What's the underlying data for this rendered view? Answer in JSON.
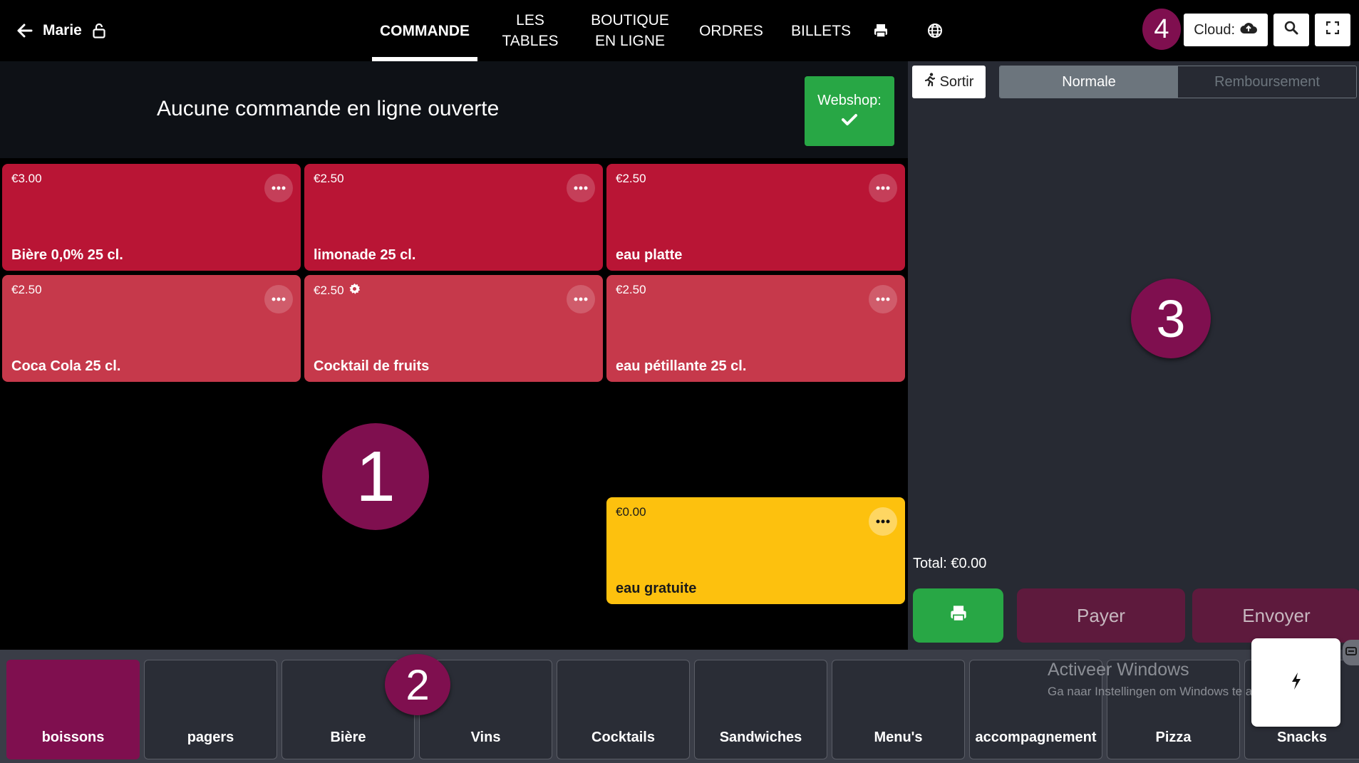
{
  "header": {
    "user_name": "Marie",
    "nav": [
      {
        "line1": "COMMANDE",
        "line2": ""
      },
      {
        "line1": "LES",
        "line2": "TABLES"
      },
      {
        "line1": "BOUTIQUE",
        "line2": "EN LIGNE"
      },
      {
        "line1": "ORDRES",
        "line2": ""
      },
      {
        "line1": "BILLETS",
        "line2": ""
      }
    ],
    "cloud_label": "Cloud:",
    "icons": [
      "back-arrow-icon",
      "lock-icon",
      "printer-icon",
      "globe-icon",
      "cloud-upload-icon",
      "search-icon",
      "fullscreen-icon"
    ]
  },
  "webshop": {
    "message": "Aucune commande en ligne ouverte",
    "button_label": "Webshop:",
    "status_icon": "check-icon",
    "button_color": "#28a745"
  },
  "products": [
    {
      "price": "€3.00",
      "name": "Bière 0,0% 25 cl.",
      "color": "#b91535"
    },
    {
      "price": "€2.50",
      "name": "limonade 25 cl.",
      "color": "#b91535"
    },
    {
      "price": "€2.50",
      "name": "eau platte",
      "color": "#b91535"
    },
    {
      "price": "€2.50",
      "name": "Coca Cola 25 cl.",
      "color": "#c6394b"
    },
    {
      "price": "€2.50",
      "name": "Cocktail de fruits",
      "color": "#c6394b",
      "has_options_icon": true
    },
    {
      "price": "€2.50",
      "name": "eau pétillante 25 cl.",
      "color": "#c6394b"
    },
    {
      "price": "€0.00",
      "name": "eau gratuite",
      "color": "#fdc10e"
    }
  ],
  "order_panel": {
    "exit_label": "Sortir",
    "mode_tabs": [
      "Normale",
      "Remboursement"
    ],
    "total_text": "Total: €0.00",
    "pay_label": "Payer",
    "send_label": "Envoyer"
  },
  "categories": [
    "boissons",
    "pagers",
    "Bière",
    "Vins",
    "Cocktails",
    "Sandwiches",
    "Menu's",
    "accompagnement",
    "Pizza",
    "Snacks"
  ],
  "windows_watermark": {
    "title": "Activeer Windows",
    "subtitle": "Ga naar Instellingen om Windows te activeren."
  },
  "callouts": [
    "1",
    "2",
    "3",
    "4"
  ],
  "colors": {
    "accent": "#7f0f4f",
    "panel": "#272a33",
    "success": "#28a745"
  }
}
